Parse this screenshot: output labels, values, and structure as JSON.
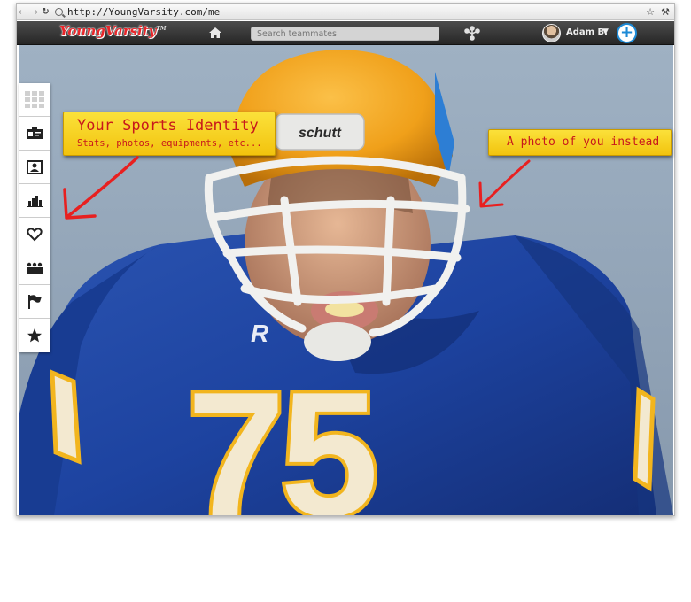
{
  "browser": {
    "url": "http://YoungVarsity.com/me",
    "back_icon": "arrow-left-icon",
    "forward_icon": "arrow-right-icon",
    "reload_icon": "reload-icon",
    "bookmark_icon": "star-icon",
    "settings_icon": "wrench-icon"
  },
  "topnav": {
    "logo": "YoungVarsity",
    "logo_tm": "TM",
    "home_icon": "home-icon",
    "search_placeholder": "Search teammates",
    "network_icon": "network-nodes-icon",
    "user_name": "Adam B.",
    "dropdown_icon": "caret-down-icon",
    "add_icon": "plus-circle-icon"
  },
  "sidebar": {
    "items": [
      {
        "icon": "grid-icon"
      },
      {
        "icon": "id-card-icon"
      },
      {
        "icon": "profile-card-icon"
      },
      {
        "icon": "bar-chart-icon"
      },
      {
        "icon": "heart-icon"
      },
      {
        "icon": "team-icon"
      },
      {
        "icon": "flag-icon"
      },
      {
        "icon": "star-icon"
      }
    ]
  },
  "callouts": {
    "identity_title": "Your Sports Identity",
    "identity_sub": "Stats, photos, equipments, etc...",
    "photo_note": "A photo of you instead"
  },
  "hero": {
    "helmet_brand": "schutt",
    "jersey_brand": "R",
    "jersey_number": "75"
  },
  "colors": {
    "accent": "#1d8ad6",
    "callout": "#f5cc18",
    "callout_text": "#c8181c",
    "jersey": "#1c3f96",
    "helmet": "#f2a31c"
  }
}
